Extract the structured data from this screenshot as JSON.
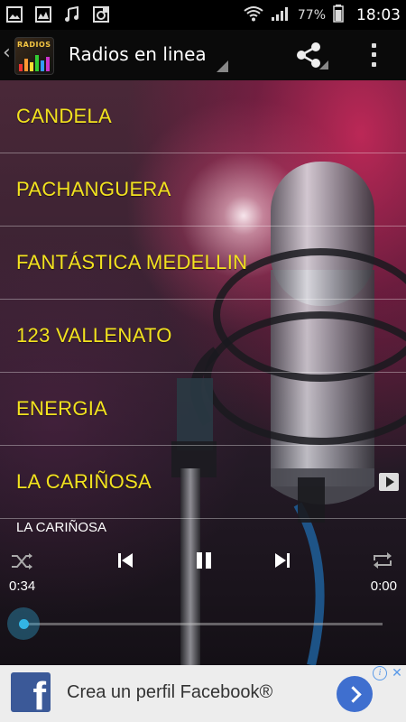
{
  "status_bar": {
    "battery": "77%",
    "time": "18:03",
    "left_icons": [
      "image-icon",
      "gallery-icon",
      "music-note-icon",
      "notification-icon"
    ],
    "right_icons": [
      "wifi-icon",
      "signal-icon",
      "battery-icon"
    ]
  },
  "app_bar": {
    "title": "Radios en linea",
    "logo_text": "RADIOS",
    "actions": [
      "share-icon",
      "overflow-menu-icon"
    ]
  },
  "stations": [
    {
      "label": "CANDELA"
    },
    {
      "label": "PACHANGUERA"
    },
    {
      "label": "FANTÁSTICA MEDELLIN"
    },
    {
      "label": "123 VALLENATO"
    },
    {
      "label": "ENERGIA"
    },
    {
      "label": "LA CARIÑOSA"
    }
  ],
  "player": {
    "now_playing": "LA CARIÑOSA",
    "elapsed": "0:34",
    "total": "0:00",
    "progress": 0,
    "accent_color": "#33b5e5"
  },
  "ad": {
    "text": "Crea un perfil Facebook®",
    "logo_letter": "f",
    "info_glyph": "i",
    "close_glyph": "✕",
    "brand_color": "#3b5998"
  },
  "colors": {
    "station_text": "#f2e21f",
    "app_bar_bg": "#0a0a0a"
  }
}
